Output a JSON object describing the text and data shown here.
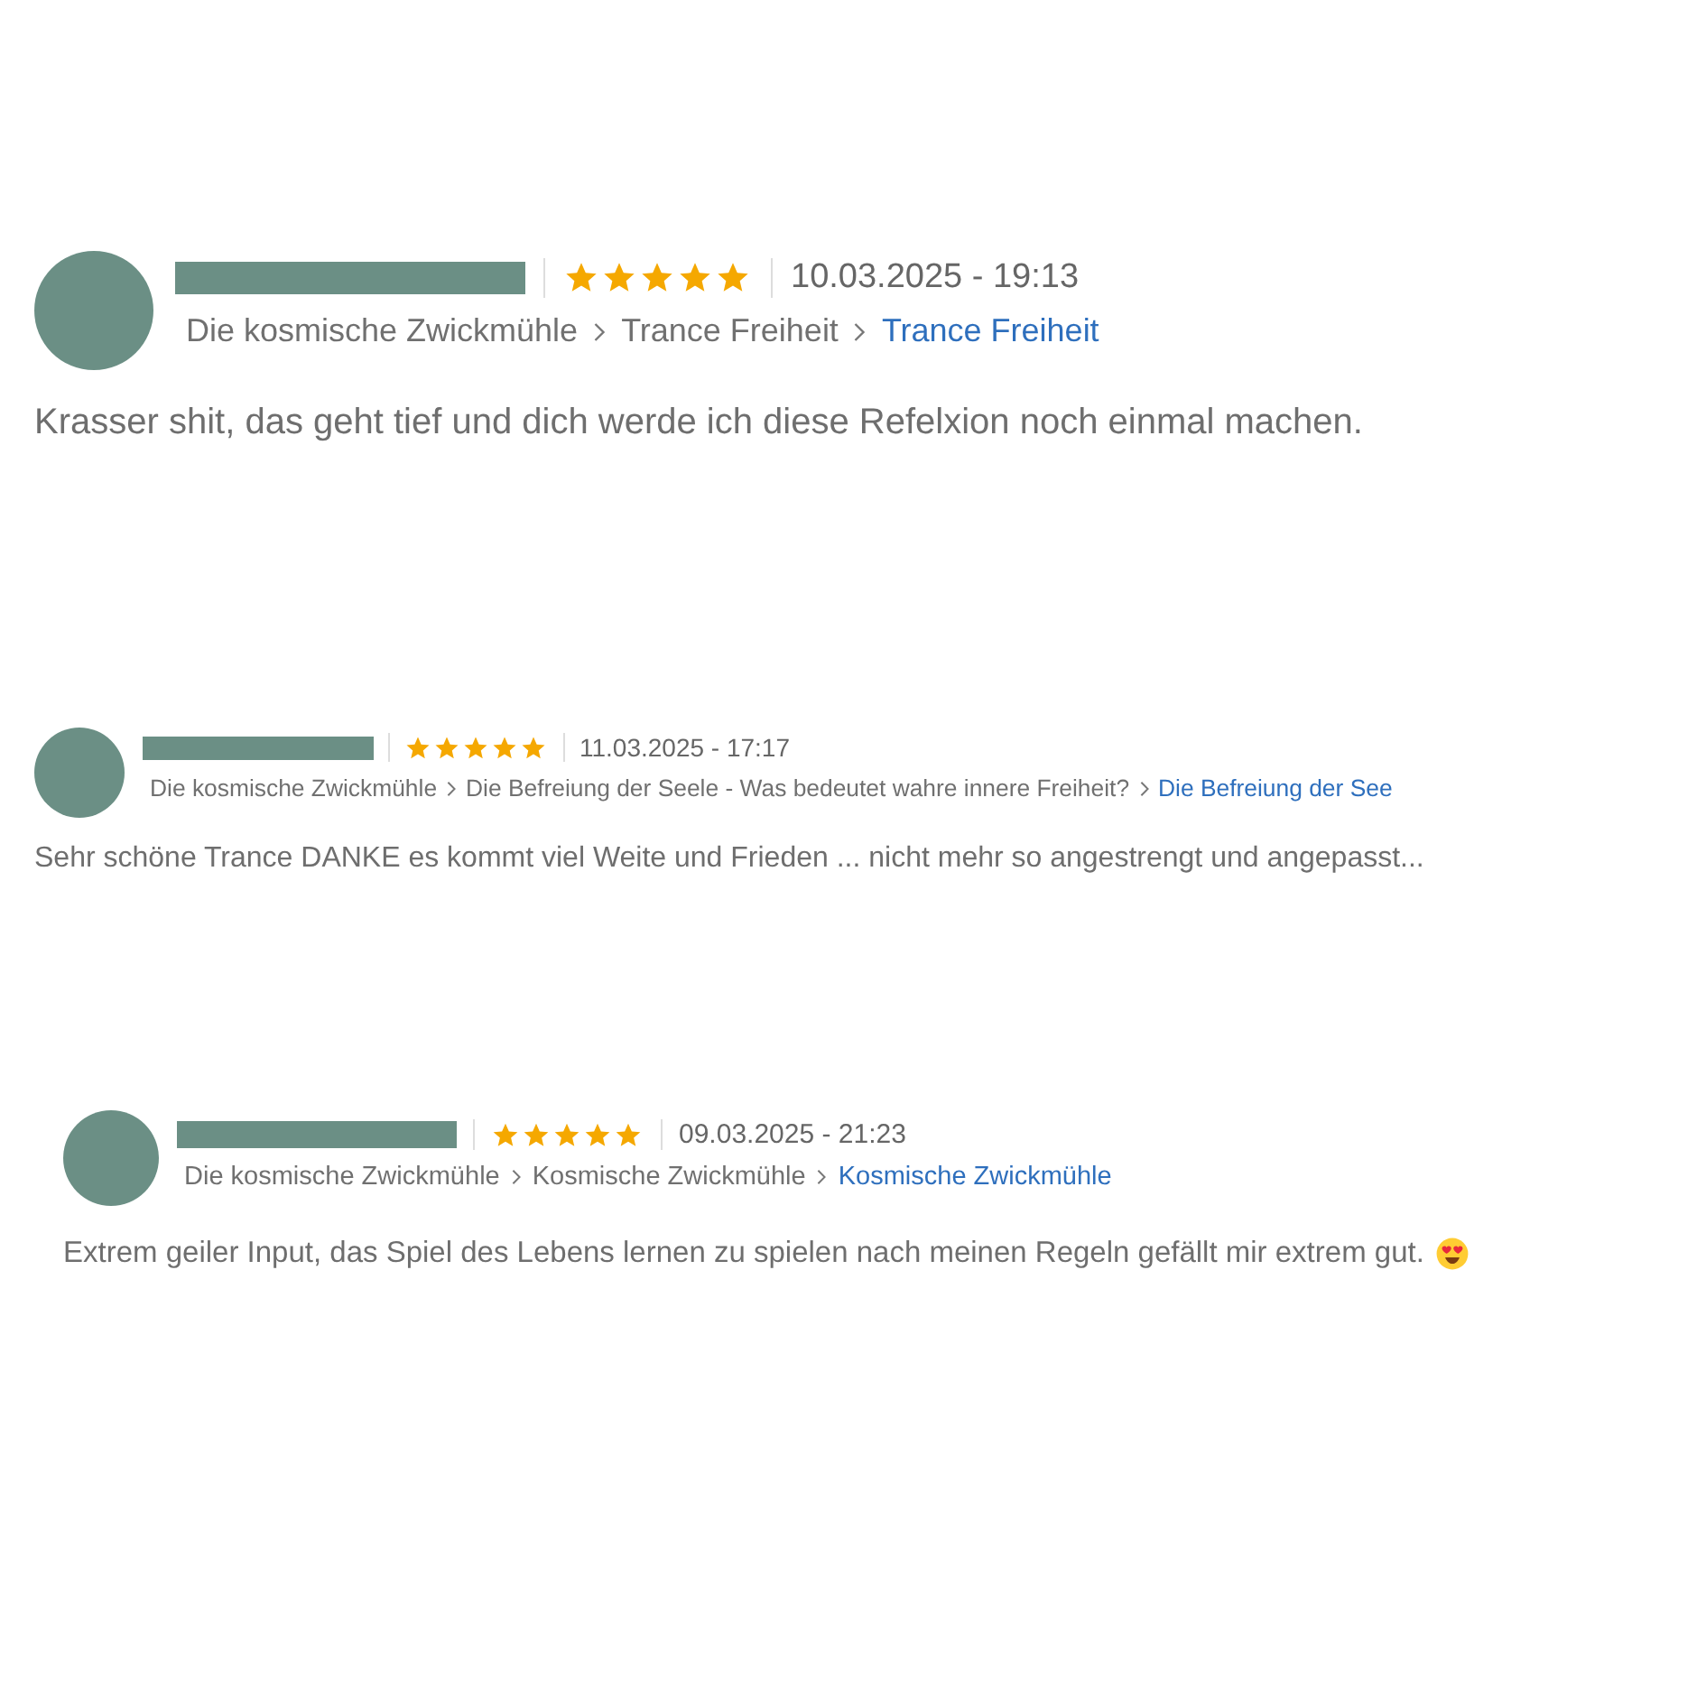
{
  "reviews": [
    {
      "stars": 5,
      "date": "10.03.2025 - 19:13",
      "breadcrumb": [
        "Die kosmische Zwickmühle",
        "Trance Freiheit",
        "Trance Freiheit"
      ],
      "comment": "Krasser shit, das geht tief und dich werde ich diese Refelxion noch einmal machen.",
      "emoji": false
    },
    {
      "stars": 5,
      "date": "11.03.2025 - 17:17",
      "breadcrumb": [
        "Die kosmische Zwickmühle",
        "Die Befreiung der Seele - Was bedeutet wahre innere Freiheit?",
        "Die Befreiung der See"
      ],
      "comment": "Sehr schöne Trance DANKE es kommt viel Weite und Frieden ...  nicht mehr so angestrengt und angepasst...",
      "emoji": false
    },
    {
      "stars": 5,
      "date": "09.03.2025 - 21:23",
      "breadcrumb": [
        "Die kosmische Zwickmühle",
        "Kosmische Zwickmühle",
        "Kosmische Zwickmühle"
      ],
      "comment": "Extrem geiler Input, das Spiel des Lebens lernen zu spielen nach meinen Regeln gefällt mir extrem gut.",
      "emoji": true
    }
  ]
}
